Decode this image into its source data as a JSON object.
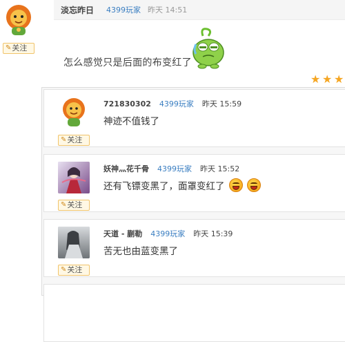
{
  "post": {
    "username": "淡忘昨日",
    "tag": "4399玩家",
    "time": "昨天  14:51",
    "text": "怎么感觉只是后面的布变红了",
    "follow_label": "关注",
    "star_count": 3
  },
  "replies": [
    {
      "username": "721830302",
      "tag": "4399玩家",
      "time": "昨天  15:59",
      "text": "神迹不值钱了",
      "follow_label": "关注",
      "avatar_icon": "lion-avatar-icon"
    },
    {
      "username": "妖神灬花千骨",
      "tag": "4399玩家",
      "time": "昨天  15:52",
      "text": "还有飞镖变黑了，面罩变红了",
      "follow_label": "关注",
      "avatar_icon": "anime-girl-avatar-icon",
      "emoji_count": 2
    },
    {
      "username": "天道 - 蒯勒",
      "tag": "4399玩家",
      "time": "昨天  15:39",
      "text": "苦无也由蓝变黑了",
      "follow_label": "关注",
      "avatar_icon": "gray-figure-avatar-icon"
    }
  ],
  "colors": {
    "tag_blue": "#3a7ec1",
    "follow_border": "#f0c36a",
    "follow_bg": "#fff8e4",
    "star": "#f5a623"
  }
}
